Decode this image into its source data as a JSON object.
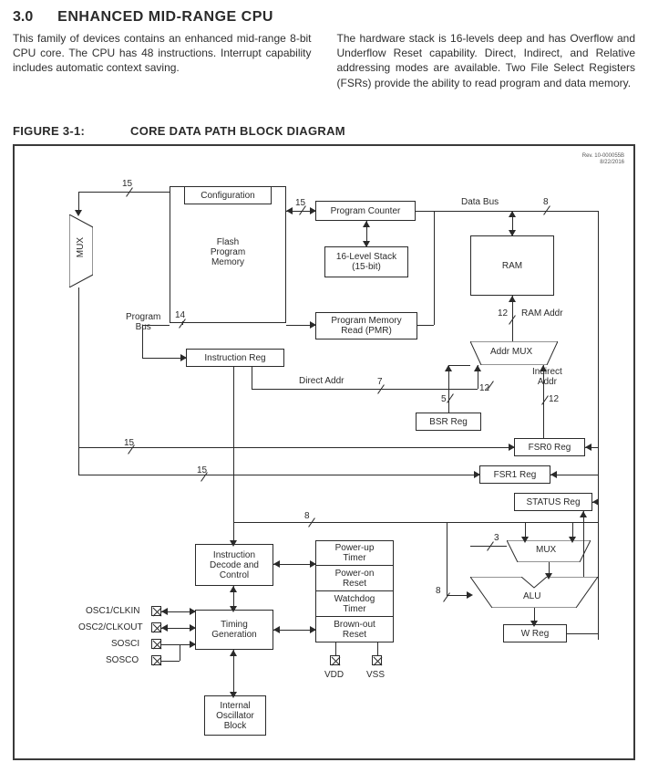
{
  "section": {
    "num": "3.0",
    "title": "ENHANCED MID-RANGE CPU"
  },
  "para": {
    "left": "This family of devices contains an enhanced mid-range 8-bit CPU core. The CPU has 48 instructions. Interrupt capability includes automatic context saving.",
    "right": "The hardware stack is 16-levels deep and has Overflow and Underflow Reset capability. Direct, Indirect, and Relative addressing modes are available. Two File Select Registers (FSRs) provide the ability to read program and data memory."
  },
  "figure": {
    "id": "FIGURE 3-1:",
    "title": "CORE DATA PATH BLOCK DIAGRAM"
  },
  "rev": {
    "a": "Rev. 10-000055B",
    "b": "8/22/2016"
  },
  "blocks": {
    "configuration": "Configuration",
    "flash": "Flash\nProgram\nMemory",
    "mux_left": "MUX",
    "pc": "Program Counter",
    "stack": "16-Level Stack\n(15-bit)",
    "pmr": "Program Memory\nRead (PMR)",
    "ireg": "Instruction Reg",
    "ram": "RAM",
    "addrmux": "Addr MUX",
    "bsr": "BSR Reg",
    "fsr0": "FSR0 Reg",
    "fsr1": "FSR1 Reg",
    "status": "STATUS Reg",
    "mux_right": "MUX",
    "alu": "ALU",
    "wreg": "W Reg",
    "idc": "Instruction\nDecode and\nControl",
    "timing": "Timing\nGeneration",
    "iob": "Internal\nOscillator\nBlock",
    "put": "Power-up\nTimer",
    "por": "Power-on\nReset",
    "wdt": "Watchdog\nTimer",
    "bor": "Brown-out\nReset"
  },
  "labels": {
    "databus": "Data Bus",
    "ramaddr": "RAM Addr",
    "programbus": "Program\nBus",
    "directaddr": "Direct Addr",
    "indirectaddr": "Indirect\nAddr",
    "osc1": "OSC1/CLKIN",
    "osc2": "OSC2/CLKOUT",
    "sosci": "SOSCI",
    "sosco": "SOSCO",
    "vdd": "VDD",
    "vss": "VSS"
  },
  "bus": {
    "b15a": "15",
    "b15b": "15",
    "b15c": "15",
    "b15d": "15",
    "b14": "14",
    "b8a": "8",
    "b8b": "8",
    "b8c": "8",
    "b7": "7",
    "b5": "5",
    "b12a": "12",
    "b12b": "12",
    "b12c": "12",
    "b3": "3"
  }
}
